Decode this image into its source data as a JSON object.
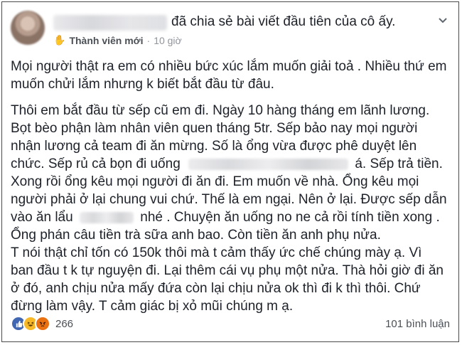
{
  "post": {
    "action_text": "đã chia sẻ bài viết đầu tiên của cô ấy.",
    "badge": "Thành viên mới",
    "separator": "·",
    "time": "10 giờ"
  },
  "body": {
    "paragraph1": [
      "Mọi người thật ra em có nhiều bức xúc lắm muốn giải toả . Nhiều thứ em",
      "muốn chửi lắm nhưng k biết bắt đầu từ đâu."
    ],
    "paragraph2": {
      "lines": [
        "Thôi em bắt đầu từ sếp cũ em đi. Ngày 10 hàng tháng em lãnh lương.",
        "Bọt bèo phận làm nhân viên quen tháng 5tr. Sếp bảo nay mọi người",
        "nhận lương cả team đi ăn mừng. Số là ổng vừa được phê duyệt lên",
        "chức. Sếp rủ cả bọn đi uống",
        "á. Sếp trả tiền.",
        "Xong rồi ổng kêu mọi người đi ăn đi. Em muốn về nhà. Ổng kêu mọi",
        "người phải ở lại chung vui chứ. Thế là em ngại. Nên ở lại. Được sếp dẫn",
        "vào ăn lẩu",
        "nhé . Chuyện ăn uống no ne cả rồi tính tiền xong .",
        "Ổng phán câu tiền trà sữa anh bao. Còn tiền ăn anh phụ nửa.",
        "T nói thật chỉ tốn có 150k thôi mà t cảm thấy ức chế chúng mày ạ. Vì",
        "ban đầu t k tự nguyện đi. Lại thêm cái vụ phụ một nửa. Thà hỏi giờ đi ăn",
        "ở đó, anh chịu nửa mấy đứa còn lại chịu nửa ok thì đi k thì thôi. Chứ",
        "đừng làm vậy. T cảm giác bị xỏ mũi chúng m ạ."
      ]
    }
  },
  "footer": {
    "reaction_count": "266",
    "comments": "101 bình luận"
  },
  "icons": {
    "wave": "waving-hand-icon",
    "chevron": "chevron-down-icon",
    "reactions": [
      "like-reaction-icon",
      "haha-reaction-icon",
      "angry-reaction-icon"
    ]
  },
  "colors": {
    "text": "#1d2129",
    "secondary": "#4b4f56",
    "muted": "#90949c",
    "like": "#4267b2",
    "haha": "#f7b928",
    "angry": "#e9710f"
  }
}
